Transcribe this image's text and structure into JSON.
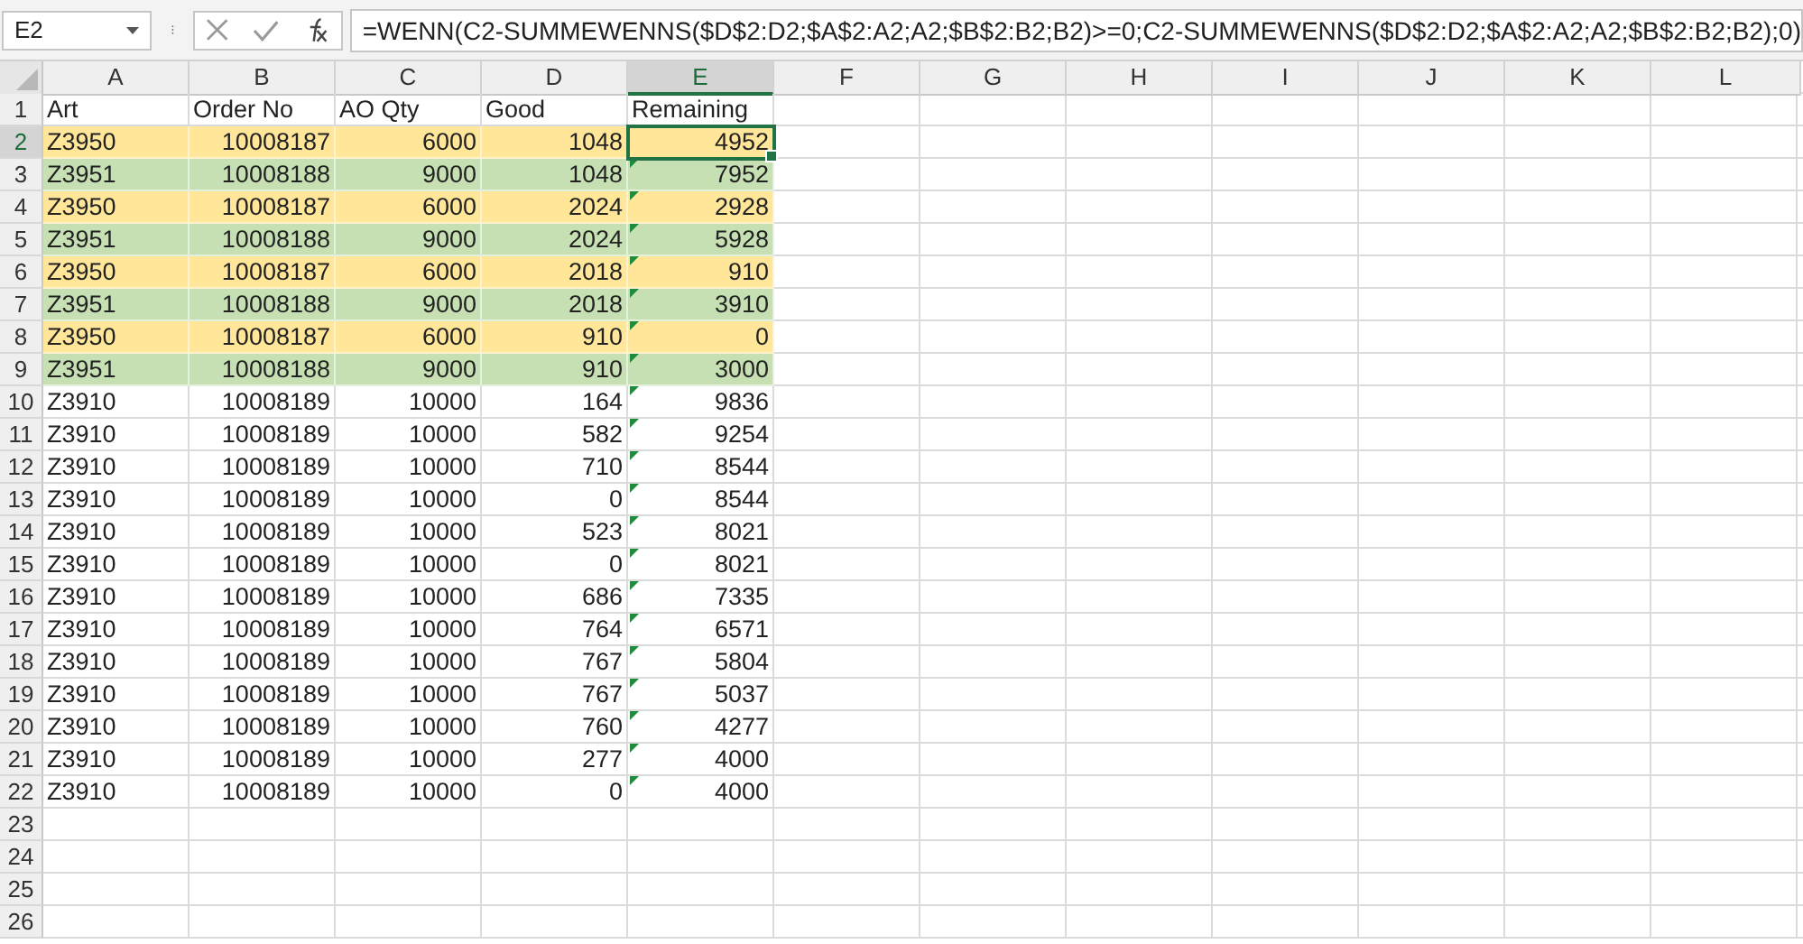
{
  "name_box": "E2",
  "formula": "=WENN(C2-SUMMEWENNS($D$2:D2;$A$2:A2;A2;$B$2:B2;B2)>=0;C2-SUMMEWENNS($D$2:D2;$A$2:A2;A2;$B$2:B2;B2);0)",
  "columns": [
    {
      "label": "A",
      "selected": false
    },
    {
      "label": "B",
      "selected": false
    },
    {
      "label": "C",
      "selected": false
    },
    {
      "label": "D",
      "selected": false
    },
    {
      "label": "E",
      "selected": true
    },
    {
      "label": "F",
      "selected": false
    },
    {
      "label": "G",
      "selected": false
    },
    {
      "label": "H",
      "selected": false
    },
    {
      "label": "I",
      "selected": false
    },
    {
      "label": "J",
      "selected": false
    },
    {
      "label": "K",
      "selected": false
    },
    {
      "label": "L",
      "selected": false
    }
  ],
  "rows": [
    {
      "number": "1",
      "kind": "header",
      "selected": false,
      "cells": [
        "Art",
        "Order No",
        "AO Qty",
        "Good",
        "Remaining"
      ]
    },
    {
      "number": "2",
      "kind": "data",
      "selected": true,
      "color": "#ffe699",
      "cells": [
        "Z3950",
        "10008187",
        "6000",
        "1048",
        "4952"
      ]
    },
    {
      "number": "3",
      "kind": "data",
      "selected": false,
      "flagged": true,
      "color": "#c6e0b4",
      "cells": [
        "Z3951",
        "10008188",
        "9000",
        "1048",
        "7952"
      ]
    },
    {
      "number": "4",
      "kind": "data",
      "selected": false,
      "flagged": true,
      "color": "#ffe699",
      "cells": [
        "Z3950",
        "10008187",
        "6000",
        "2024",
        "2928"
      ]
    },
    {
      "number": "5",
      "kind": "data",
      "selected": false,
      "flagged": true,
      "color": "#c6e0b4",
      "cells": [
        "Z3951",
        "10008188",
        "9000",
        "2024",
        "5928"
      ]
    },
    {
      "number": "6",
      "kind": "data",
      "selected": false,
      "flagged": true,
      "color": "#ffe699",
      "cells": [
        "Z3950",
        "10008187",
        "6000",
        "2018",
        "910"
      ]
    },
    {
      "number": "7",
      "kind": "data",
      "selected": false,
      "flagged": true,
      "color": "#c6e0b4",
      "cells": [
        "Z3951",
        "10008188",
        "9000",
        "2018",
        "3910"
      ]
    },
    {
      "number": "8",
      "kind": "data",
      "selected": false,
      "flagged": true,
      "color": "#ffe699",
      "cells": [
        "Z3950",
        "10008187",
        "6000",
        "910",
        "0"
      ]
    },
    {
      "number": "9",
      "kind": "data",
      "selected": false,
      "flagged": true,
      "color": "#c6e0b4",
      "cells": [
        "Z3951",
        "10008188",
        "9000",
        "910",
        "3000"
      ]
    },
    {
      "number": "10",
      "kind": "data",
      "selected": false,
      "flagged": true,
      "cells": [
        "Z3910",
        "10008189",
        "10000",
        "164",
        "9836"
      ]
    },
    {
      "number": "11",
      "kind": "data",
      "selected": false,
      "flagged": true,
      "cells": [
        "Z3910",
        "10008189",
        "10000",
        "582",
        "9254"
      ]
    },
    {
      "number": "12",
      "kind": "data",
      "selected": false,
      "flagged": true,
      "cells": [
        "Z3910",
        "10008189",
        "10000",
        "710",
        "8544"
      ]
    },
    {
      "number": "13",
      "kind": "data",
      "selected": false,
      "flagged": true,
      "cells": [
        "Z3910",
        "10008189",
        "10000",
        "0",
        "8544"
      ]
    },
    {
      "number": "14",
      "kind": "data",
      "selected": false,
      "flagged": true,
      "cells": [
        "Z3910",
        "10008189",
        "10000",
        "523",
        "8021"
      ]
    },
    {
      "number": "15",
      "kind": "data",
      "selected": false,
      "flagged": true,
      "cells": [
        "Z3910",
        "10008189",
        "10000",
        "0",
        "8021"
      ]
    },
    {
      "number": "16",
      "kind": "data",
      "selected": false,
      "flagged": true,
      "cells": [
        "Z3910",
        "10008189",
        "10000",
        "686",
        "7335"
      ]
    },
    {
      "number": "17",
      "kind": "data",
      "selected": false,
      "flagged": true,
      "cells": [
        "Z3910",
        "10008189",
        "10000",
        "764",
        "6571"
      ]
    },
    {
      "number": "18",
      "kind": "data",
      "selected": false,
      "flagged": true,
      "cells": [
        "Z3910",
        "10008189",
        "10000",
        "767",
        "5804"
      ]
    },
    {
      "number": "19",
      "kind": "data",
      "selected": false,
      "flagged": true,
      "cells": [
        "Z3910",
        "10008189",
        "10000",
        "767",
        "5037"
      ]
    },
    {
      "number": "20",
      "kind": "data",
      "selected": false,
      "flagged": true,
      "cells": [
        "Z3910",
        "10008189",
        "10000",
        "760",
        "4277"
      ]
    },
    {
      "number": "21",
      "kind": "data",
      "selected": false,
      "flagged": true,
      "cells": [
        "Z3910",
        "10008189",
        "10000",
        "277",
        "4000"
      ]
    },
    {
      "number": "22",
      "kind": "data",
      "selected": false,
      "flagged": true,
      "cells": [
        "Z3910",
        "10008189",
        "10000",
        "0",
        "4000"
      ]
    },
    {
      "number": "23",
      "kind": "empty",
      "selected": false
    },
    {
      "number": "24",
      "kind": "empty",
      "selected": false
    },
    {
      "number": "25",
      "kind": "empty",
      "selected": false
    },
    {
      "number": "26",
      "kind": "empty",
      "selected": false
    }
  ]
}
